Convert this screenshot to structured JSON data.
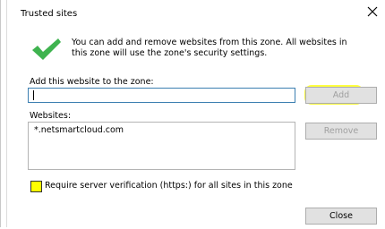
{
  "dialog": {
    "title": "Trusted sites",
    "info_line1": "You can add and remove websites from this zone. All websites in",
    "info_line2": "this zone will use the zone's security settings.",
    "add_label": "Add this website to the zone:",
    "add_input_value": "",
    "add_button": "Add",
    "websites_label": "Websites:",
    "websites": [
      "*.netsmartcloud.com"
    ],
    "remove_button": "Remove",
    "require_verification_label": "Require server verification (https:) for all sites in this zone",
    "require_verification_checked": false,
    "close_button": "Close"
  },
  "colors": {
    "highlight": "#ffff00",
    "check_green": "#3fb34f",
    "input_border": "#3c7fb1",
    "button_bg": "#e1e1e1"
  },
  "icons": {
    "close": "close-icon",
    "check": "checkmark-icon"
  }
}
